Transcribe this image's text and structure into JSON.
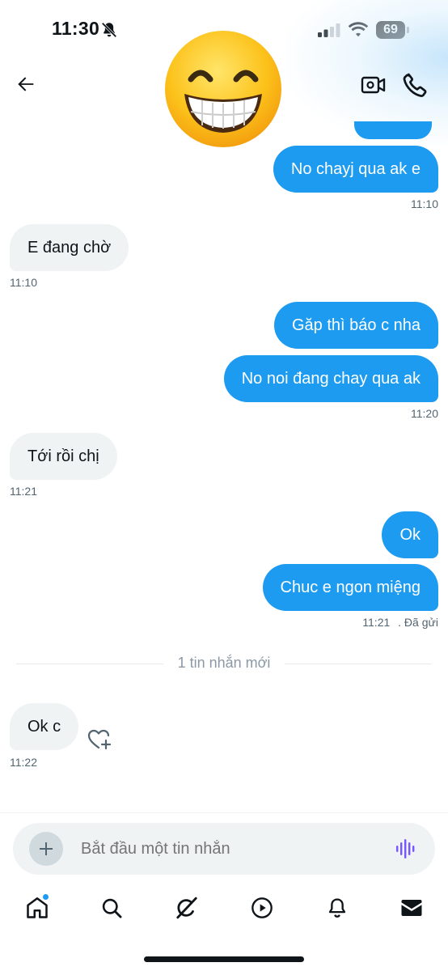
{
  "status_bar": {
    "time": "11:30",
    "battery": "69",
    "icons": [
      "bell-muted-icon",
      "signal-icon",
      "wifi-icon",
      "battery-icon"
    ]
  },
  "header": {
    "avatar": "grinning-face-emoji",
    "icons": [
      "back-arrow-icon",
      "video-camera-icon",
      "phone-icon"
    ]
  },
  "messages": [
    {
      "direction": "out",
      "text": "No chayj qua ak e",
      "time": "11:10"
    },
    {
      "direction": "in",
      "text": "E đang chờ",
      "time": "11:10"
    },
    {
      "direction": "out",
      "text": "Găp thì báo c nha",
      "time": ""
    },
    {
      "direction": "out",
      "text": "No noi đang chay qua ak",
      "time": "11:20"
    },
    {
      "direction": "in",
      "text": "Tới rồi chị",
      "time": "11:21"
    },
    {
      "direction": "out",
      "text": "Ok",
      "time": ""
    },
    {
      "direction": "out",
      "text": "Chuc e ngon miệng",
      "time": "11:21",
      "status": ". Đã gửi"
    },
    {
      "direction": "in",
      "text": "Ok c",
      "time": "11:22"
    }
  ],
  "divider": {
    "label": "1 tin nhắn mới"
  },
  "composer": {
    "placeholder": "Bắt đầu một tin nhắn",
    "icons": [
      "plus-icon",
      "voice-waveform-icon"
    ]
  },
  "tabbar": {
    "items": [
      "home-icon",
      "search-icon",
      "grok-icon",
      "video-icon",
      "notifications-icon",
      "messages-icon"
    ],
    "active": "messages-icon",
    "home_has_badge": true
  },
  "colors": {
    "accent": "#1d9bf0",
    "incoming_bubble": "#eff3f4",
    "text": "#0f1419",
    "muted": "#536471",
    "voice_icon": "#7856ff"
  }
}
